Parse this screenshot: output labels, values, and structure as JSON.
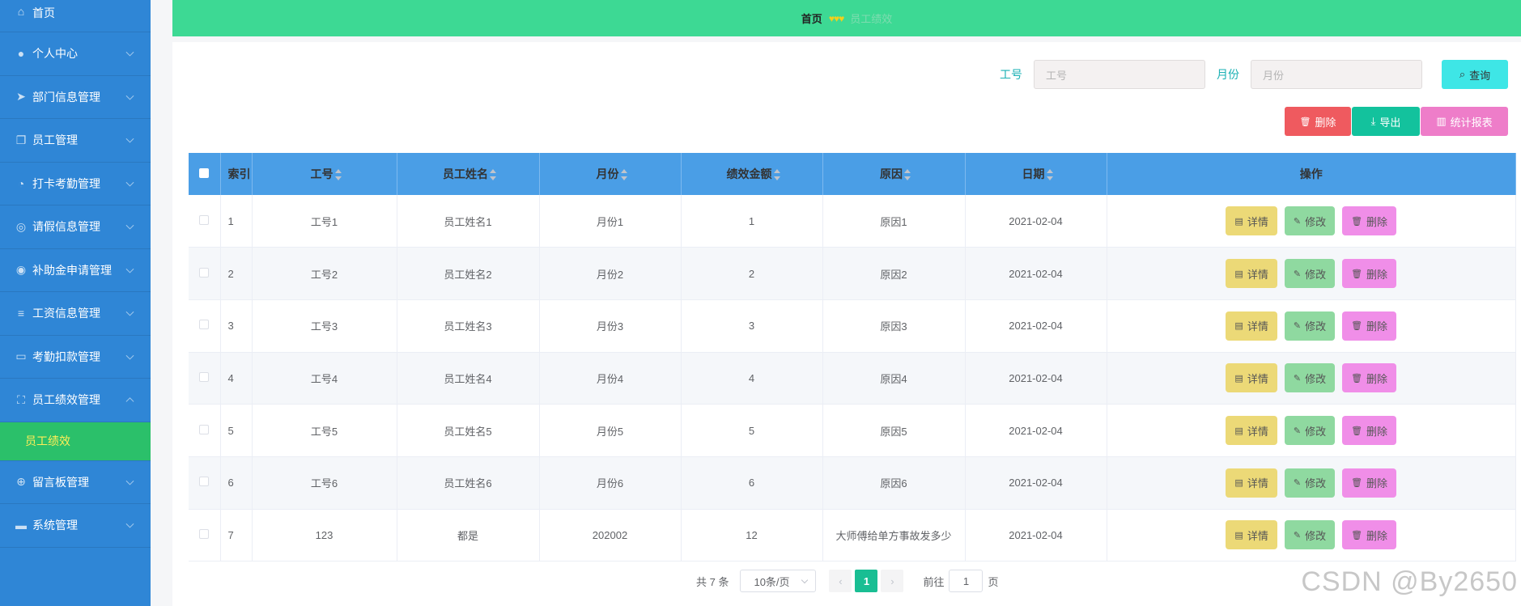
{
  "sidebar": {
    "items": [
      {
        "label": "首页",
        "icon": "home-icon",
        "glyph": "⌂"
      },
      {
        "label": "个人中心",
        "icon": "user-icon",
        "glyph": "●"
      },
      {
        "label": "部门信息管理",
        "icon": "send-icon",
        "glyph": "➤"
      },
      {
        "label": "员工管理",
        "icon": "copy-icon",
        "glyph": "❐"
      },
      {
        "label": "打卡考勤管理",
        "icon": "compass-icon",
        "glyph": "◔"
      },
      {
        "label": "请假信息管理",
        "icon": "basketball-icon",
        "glyph": "◎"
      },
      {
        "label": "补助金申请管理",
        "icon": "compass-icon",
        "glyph": "◉"
      },
      {
        "label": "工资信息管理",
        "icon": "operation-icon",
        "glyph": "≡"
      },
      {
        "label": "考勤扣款管理",
        "icon": "chat-icon",
        "glyph": "▭"
      },
      {
        "label": "员工绩效管理",
        "icon": "full-screen-icon",
        "glyph": "⛶"
      },
      {
        "label": "留言板管理",
        "icon": "help-icon",
        "glyph": "⊕"
      },
      {
        "label": "系统管理",
        "icon": "ticket-icon",
        "glyph": "▬"
      }
    ],
    "submenu_active": "员工绩效",
    "active_color": "#2bc06a"
  },
  "breadcrumb": {
    "home": "首页",
    "separator": "♥♥♥",
    "current": "员工绩效"
  },
  "search": {
    "emp_label": "工号",
    "emp_placeholder": "工号",
    "month_label": "月份",
    "month_placeholder": "月份",
    "query_button": "查询"
  },
  "toolbar": {
    "delete": "删除",
    "export": "导出",
    "report": "统计报表"
  },
  "table": {
    "headers": {
      "index": "索引",
      "emp_no": "工号",
      "name": "员工姓名",
      "month": "月份",
      "amount": "绩效金额",
      "reason": "原因",
      "date": "日期",
      "ops": "操作"
    },
    "op_labels": {
      "detail": "详情",
      "edit": "修改",
      "delete": "删除"
    },
    "rows": [
      {
        "index": "1",
        "emp_no": "工号1",
        "name": "员工姓名1",
        "month": "月份1",
        "amount": "1",
        "reason": "原因1",
        "date": "2021-02-04"
      },
      {
        "index": "2",
        "emp_no": "工号2",
        "name": "员工姓名2",
        "month": "月份2",
        "amount": "2",
        "reason": "原因2",
        "date": "2021-02-04"
      },
      {
        "index": "3",
        "emp_no": "工号3",
        "name": "员工姓名3",
        "month": "月份3",
        "amount": "3",
        "reason": "原因3",
        "date": "2021-02-04"
      },
      {
        "index": "4",
        "emp_no": "工号4",
        "name": "员工姓名4",
        "month": "月份4",
        "amount": "4",
        "reason": "原因4",
        "date": "2021-02-04"
      },
      {
        "index": "5",
        "emp_no": "工号5",
        "name": "员工姓名5",
        "month": "月份5",
        "amount": "5",
        "reason": "原因5",
        "date": "2021-02-04"
      },
      {
        "index": "6",
        "emp_no": "工号6",
        "name": "员工姓名6",
        "month": "月份6",
        "amount": "6",
        "reason": "原因6",
        "date": "2021-02-04"
      },
      {
        "index": "7",
        "emp_no": "123",
        "name": "都是",
        "month": "202002",
        "amount": "12",
        "reason": "大师傅给单方事故发多少",
        "date": "2021-02-04"
      }
    ]
  },
  "pagination": {
    "total": "共 7 条",
    "page_size": "10条/页",
    "current_page": "1",
    "goto_prefix": "前往",
    "goto_value": "1",
    "goto_suffix": "页"
  },
  "watermark": "CSDN @By2650"
}
